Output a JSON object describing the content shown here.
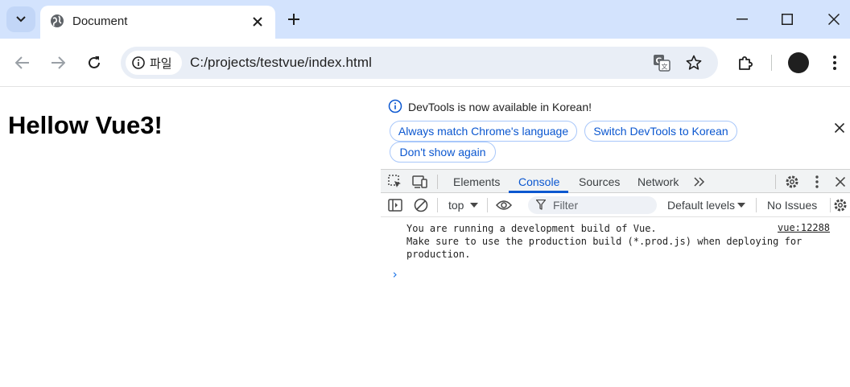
{
  "browser": {
    "tab": {
      "title": "Document"
    },
    "omnibox": {
      "site_chip": "파일",
      "url": "C:/projects/testvue/index.html"
    }
  },
  "page": {
    "heading": "Hellow Vue3!"
  },
  "devtools": {
    "infobar": {
      "message": "DevTools is now available in Korean!",
      "buttons": [
        "Always match Chrome's language",
        "Switch DevTools to Korean",
        "Don't show again"
      ]
    },
    "tabs": [
      "Elements",
      "Console",
      "Sources",
      "Network"
    ],
    "active_tab": "Console",
    "console_toolbar": {
      "context": "top",
      "filter_placeholder": "Filter",
      "levels": "Default levels",
      "issues": "No Issues"
    },
    "console": {
      "message_lines": [
        "You are running a development build of Vue.",
        "Make sure to use the production build (*.prod.js) when deploying for",
        "production."
      ],
      "source": "vue:12288",
      "prompt": "›"
    },
    "accent_color": "#0b57d0"
  }
}
